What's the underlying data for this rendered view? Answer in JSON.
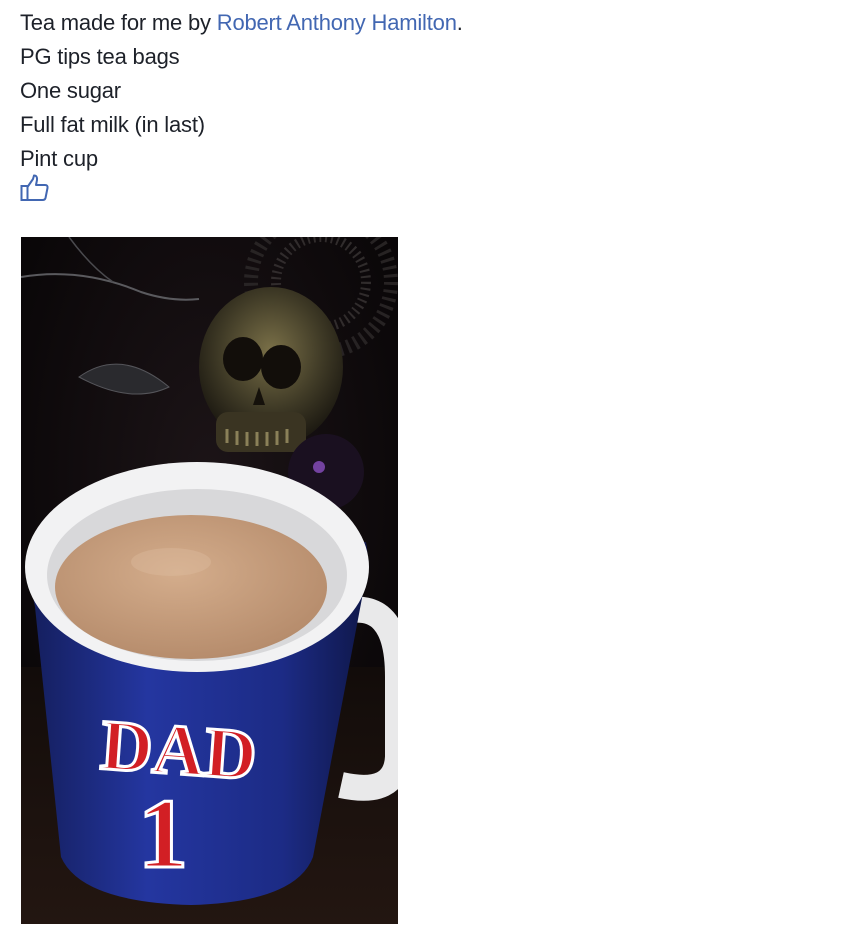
{
  "post": {
    "intro_text": "Tea made for me by ",
    "author_name": "Robert Anthony Hamilton",
    "intro_end": ".",
    "lines": [
      "PG tips tea bags",
      "One sugar",
      "Full fat milk (in last)",
      "Pint cup"
    ]
  },
  "like_button": {
    "icon": "thumbs-up-icon"
  },
  "photo": {
    "mug_text_top": "DAD",
    "mug_text_bottom": "1",
    "colors": {
      "mug_blue": "#1f2f8a",
      "mug_red": "#d21f24",
      "tea": "#c9a07f",
      "background": "#0b080a"
    }
  }
}
